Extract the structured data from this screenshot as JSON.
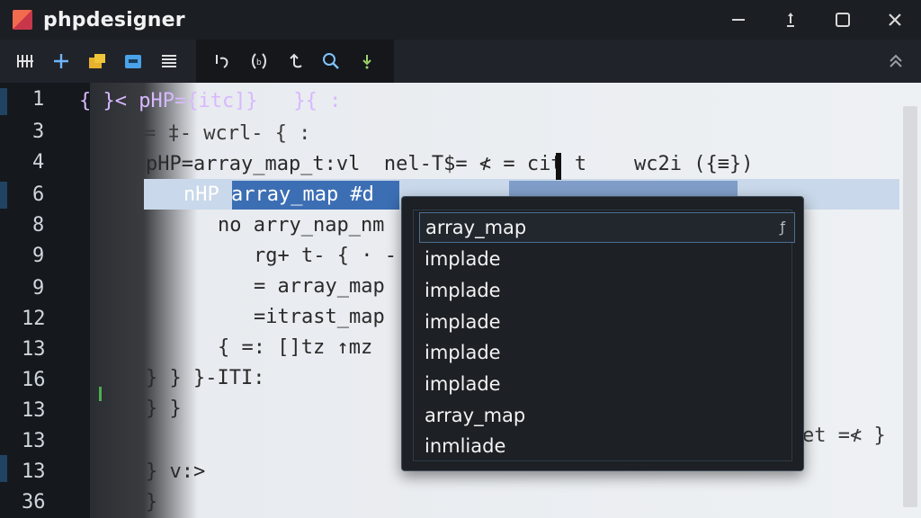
{
  "window": {
    "title": "phpdesigner"
  },
  "editor": {
    "line_numbers": [
      "1",
      "3",
      "4",
      "6",
      "8",
      "9",
      "9",
      "12",
      "13",
      "16",
      "13",
      "13",
      "13",
      "36"
    ],
    "lines": [
      "{ }< pHP={itc]}   }{ :",
      "= ‡- wcrl- { :",
      "pHP=array_map_t:vl  nel-T$= ≮ = cit t    wc2i ({≡})",
      "nHP array_map #d",
      "no arry_nap_nm",
      "rg+ t- { · -",
      "= array_map",
      "=itrast_map",
      "{ =: []tz ↑mz",
      "} } }-ITI:",
      "} }",
      "} v:>",
      "}",
      "et =≮ }"
    ]
  },
  "autocomplete": {
    "items": [
      "array_map",
      "implade",
      "implade",
      "implade",
      "implade",
      "implade",
      "array_map",
      "inmliade"
    ],
    "selected_index": 0
  }
}
